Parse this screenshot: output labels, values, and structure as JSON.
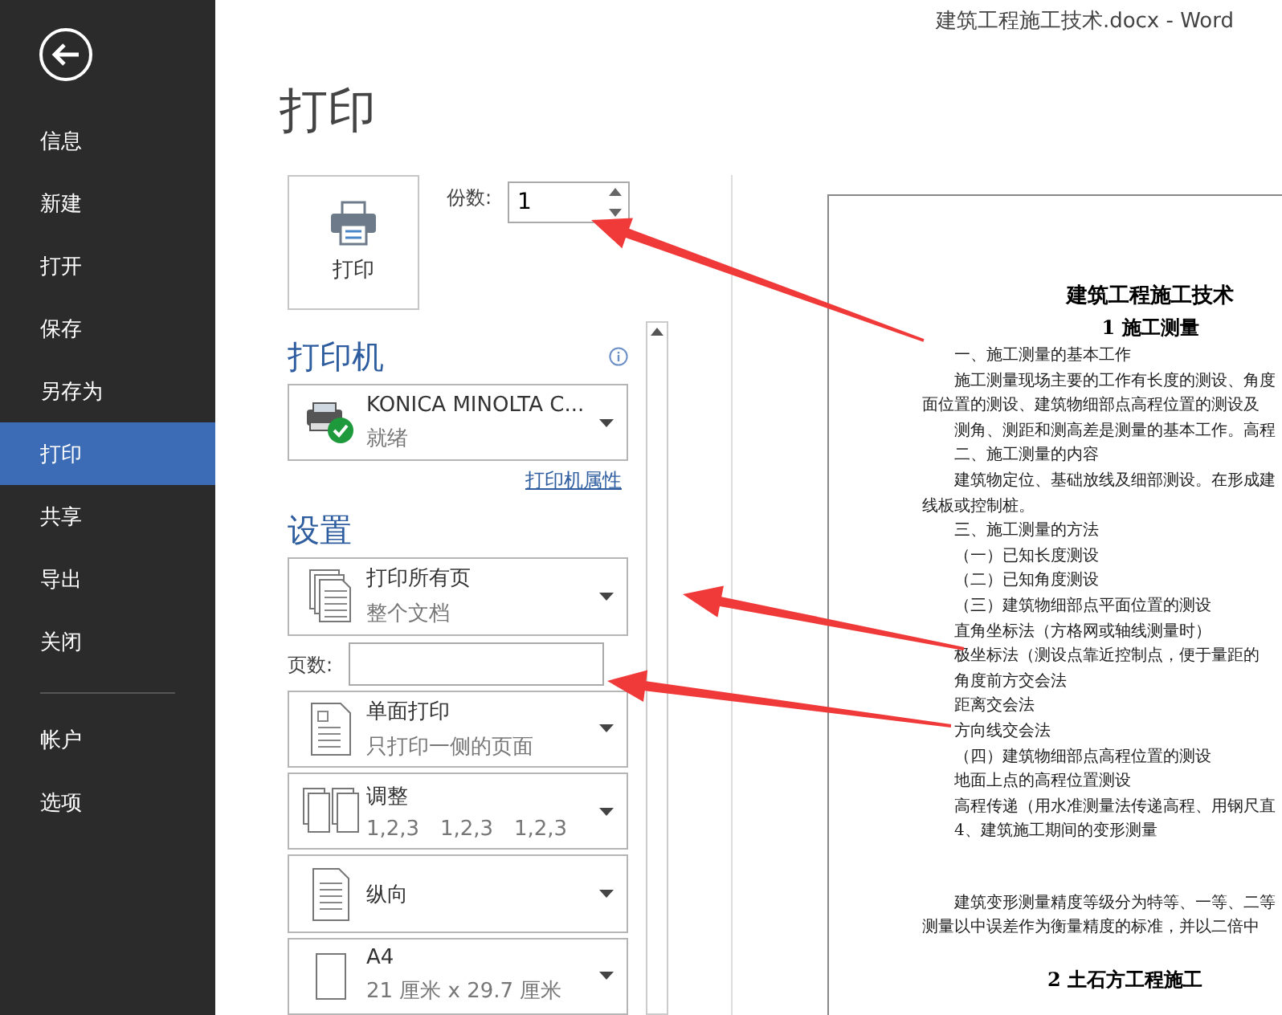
{
  "window": {
    "title": "建筑工程施工技术.docx - Word"
  },
  "sidebar": {
    "items": [
      {
        "label": "信息",
        "selected": false
      },
      {
        "label": "新建",
        "selected": false
      },
      {
        "label": "打开",
        "selected": false
      },
      {
        "label": "保存",
        "selected": false
      },
      {
        "label": "另存为",
        "selected": false
      },
      {
        "label": "打印",
        "selected": true
      },
      {
        "label": "共享",
        "selected": false
      },
      {
        "label": "导出",
        "selected": false
      },
      {
        "label": "关闭",
        "selected": false
      }
    ],
    "bottom_items": [
      {
        "label": "帐户",
        "selected": false
      },
      {
        "label": "选项",
        "selected": false
      }
    ]
  },
  "heading": "打印",
  "print_button": {
    "label": "打印"
  },
  "copies": {
    "label": "份数:",
    "value": "1"
  },
  "printer": {
    "heading": "打印机",
    "name": "KONICA MINOLTA C...",
    "status": "就绪",
    "properties_link": "打印机属性"
  },
  "settings": {
    "heading": "设置",
    "pages_label": "页数:",
    "options": [
      {
        "kind": "stack",
        "title": "打印所有页",
        "subtitle": "整个文档"
      },
      {
        "kind": "single",
        "title": "单面打印",
        "subtitle": "只打印一侧的页面"
      },
      {
        "kind": "collate",
        "title": "调整",
        "values": [
          "1,2,3",
          "1,2,3",
          "1,2,3"
        ]
      },
      {
        "kind": "portrait",
        "title": "纵向"
      },
      {
        "kind": "paper",
        "title": "A4",
        "subtitle": "21 厘米 x 29.7 厘米"
      }
    ]
  },
  "preview": {
    "title": "建筑工程施工技术",
    "subtitle": "1 施工测量",
    "lines": [
      {
        "kind": "indent",
        "text": "一、施工测量的基本工作"
      },
      {
        "kind": "indent",
        "text": "施工测量现场主要的工作有长度的测设、角度"
      },
      {
        "kind": "flush",
        "text": "面位置的测设、建筑物细部点高程位置的测设及"
      },
      {
        "kind": "indent",
        "text": "测角、测距和测高差是测量的基本工作。高程"
      },
      {
        "kind": "indent",
        "text": "二、施工测量的内容"
      },
      {
        "kind": "indent",
        "text": "建筑物定位、基础放线及细部测设。在形成建"
      },
      {
        "kind": "flush",
        "text": "线板或控制桩。"
      },
      {
        "kind": "indent",
        "text": "三、施工测量的方法"
      },
      {
        "kind": "indent",
        "text": "（一）已知长度测设"
      },
      {
        "kind": "indent",
        "text": "（二）已知角度测设"
      },
      {
        "kind": "indent",
        "text": "（三）建筑物细部点平面位置的测设"
      },
      {
        "kind": "indent",
        "text": "直角坐标法（方格网或轴线测量时）"
      },
      {
        "kind": "indent",
        "text": "极坐标法（测设点靠近控制点，便于量距的"
      },
      {
        "kind": "indent",
        "text": "角度前方交会法"
      },
      {
        "kind": "indent",
        "text": "距离交会法"
      },
      {
        "kind": "indent",
        "text": "方向线交会法"
      },
      {
        "kind": "indent",
        "text": "（四）建筑物细部点高程位置的测设"
      },
      {
        "kind": "indent",
        "text": "地面上点的高程位置测设"
      },
      {
        "kind": "indent",
        "text": "高程传递（用水准测量法传递高程、用钢尺直"
      },
      {
        "kind": "indent",
        "text": "4、建筑施工期间的变形测量"
      },
      {
        "kind": "gap",
        "text": "建筑变形测量精度等级分为特等、一等、二等"
      },
      {
        "kind": "flush",
        "text": "测量以中误差作为衡量精度的标准，并以二倍中"
      }
    ],
    "next_heading": "2 土石方工程施工"
  }
}
